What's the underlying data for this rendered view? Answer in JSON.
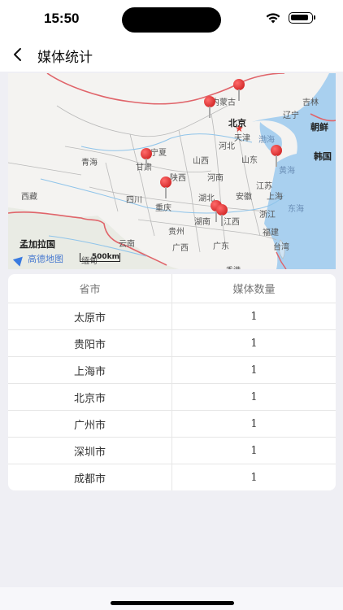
{
  "status": {
    "time": "15:50"
  },
  "nav": {
    "title": "媒体统计",
    "back_icon": "chevron-left-icon"
  },
  "map": {
    "logo": "高德地图",
    "scale": "500km",
    "labels": {
      "neimenggu": "内蒙古",
      "jilin": "吉林",
      "liaoning": "辽宁",
      "beijing": "北京",
      "chaoxian": "朝鲜",
      "tianjin": "天津",
      "bohai": "渤海",
      "hebei": "河北",
      "hanguo": "韩国",
      "ningxia": "宁夏",
      "qinghai": "青海",
      "shanxi": "山西",
      "shandong": "山东",
      "gansu": "甘肃",
      "huanghai": "黄海",
      "shaanxi": "陕西",
      "henan": "河南",
      "jiangsu": "江苏",
      "xizang": "西藏",
      "sichuan": "四川",
      "hubei": "湖北",
      "anhui": "安徽",
      "shanghai": "上海",
      "chongqing": "重庆",
      "donghai": "东海",
      "hunan": "湖南",
      "jiangxi": "江西",
      "zhejiang": "浙江",
      "guizhou": "贵州",
      "fujian": "福建",
      "mengjiala": "孟加拉国",
      "yunnan": "云南",
      "guangxi": "广西",
      "guangdong": "广东",
      "taiwan": "台湾",
      "miandian": "缅甸",
      "xianggang": "香港"
    },
    "pins": [
      "北京",
      "太原",
      "上海",
      "成都",
      "贵阳",
      "广州",
      "深圳"
    ]
  },
  "table": {
    "headers": {
      "province": "省市",
      "count": "媒体数量"
    },
    "rows": [
      {
        "city": "太原市",
        "count": "1"
      },
      {
        "city": "贵阳市",
        "count": "1"
      },
      {
        "city": "上海市",
        "count": "1"
      },
      {
        "city": "北京市",
        "count": "1"
      },
      {
        "city": "广州市",
        "count": "1"
      },
      {
        "city": "深圳市",
        "count": "1"
      },
      {
        "city": "成都市",
        "count": "1"
      }
    ]
  }
}
